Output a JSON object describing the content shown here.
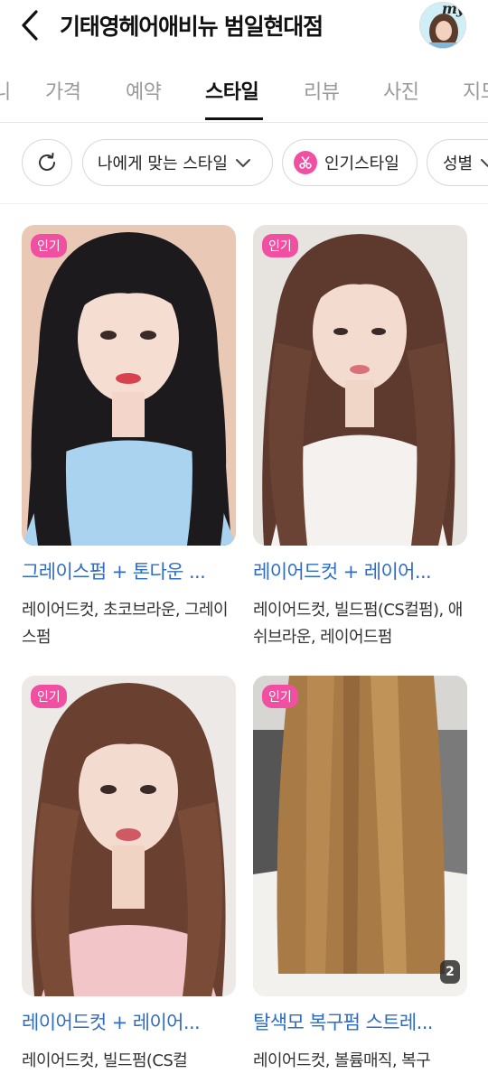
{
  "header": {
    "title": "기태영헤어애비뉴 범일현대점",
    "avatar_tag": "my"
  },
  "tabs": [
    "니",
    "가격",
    "예약",
    "스타일",
    "리뷰",
    "사진",
    "지도"
  ],
  "active_tab": "스타일",
  "filters": {
    "refresh_icon": "refresh-icon",
    "style_label": "나에게 맞는 스타일",
    "popular_label": "인기스타일",
    "gender_label": "성별"
  },
  "cards": [
    {
      "badge": "인기",
      "title": "그레이스펌 + 톤다운 ...",
      "desc": "레이어드컷, 초코브라운, 그레이스펌"
    },
    {
      "badge": "인기",
      "title": "레이어드컷 + 레이어...",
      "desc": "레이어드컷, 빌드펌(CS컬펌), 애쉬브라운, 레이어드펌"
    },
    {
      "badge": "인기",
      "title": "레이어드컷 + 레이어...",
      "desc": "레이어드컷, 빌드펌(CS컬"
    },
    {
      "badge": "인기",
      "title": "탈색모 복구펌 스트레...",
      "desc": "레이어드컷, 볼륨매직, 복구",
      "photo_count": "2"
    }
  ],
  "colors": {
    "accent_pink": "#f04fa2",
    "title_blue": "#2f6dc3"
  }
}
